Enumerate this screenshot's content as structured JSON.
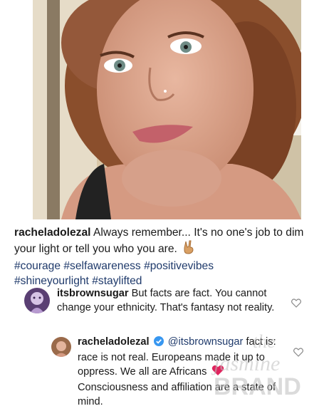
{
  "post": {
    "caption": {
      "username": "racheladolezal",
      "text": "Always remember... It's no one's job to dim your light or tell you who you are.",
      "hashtags": [
        "#courage",
        "#selfawareness",
        "#positivevibes",
        "#shineyourlight",
        "#staylifted"
      ],
      "emoji": "peace-hand-emoji"
    }
  },
  "comments": [
    {
      "username": "itsbrownsugar",
      "text": "But facts are fact. You cannot change your ethnicity. That's fantasy not reality."
    },
    {
      "username": "racheladolezal",
      "verified": true,
      "mention": "@itsbrownsugar",
      "text_before_heart": "fact is: race is not real. Europeans made it up to oppress. We all are Africans",
      "text_after_heart": "Consciousness and affiliation are a state of mind."
    }
  ],
  "watermark": {
    "lines": [
      "the",
      "jasmine",
      "BRAND"
    ]
  },
  "colors": {
    "hashtag": "#1f3a6b",
    "verified": "#3897f0",
    "heart": "#e0245e",
    "watermark": "#bdbdbd"
  }
}
